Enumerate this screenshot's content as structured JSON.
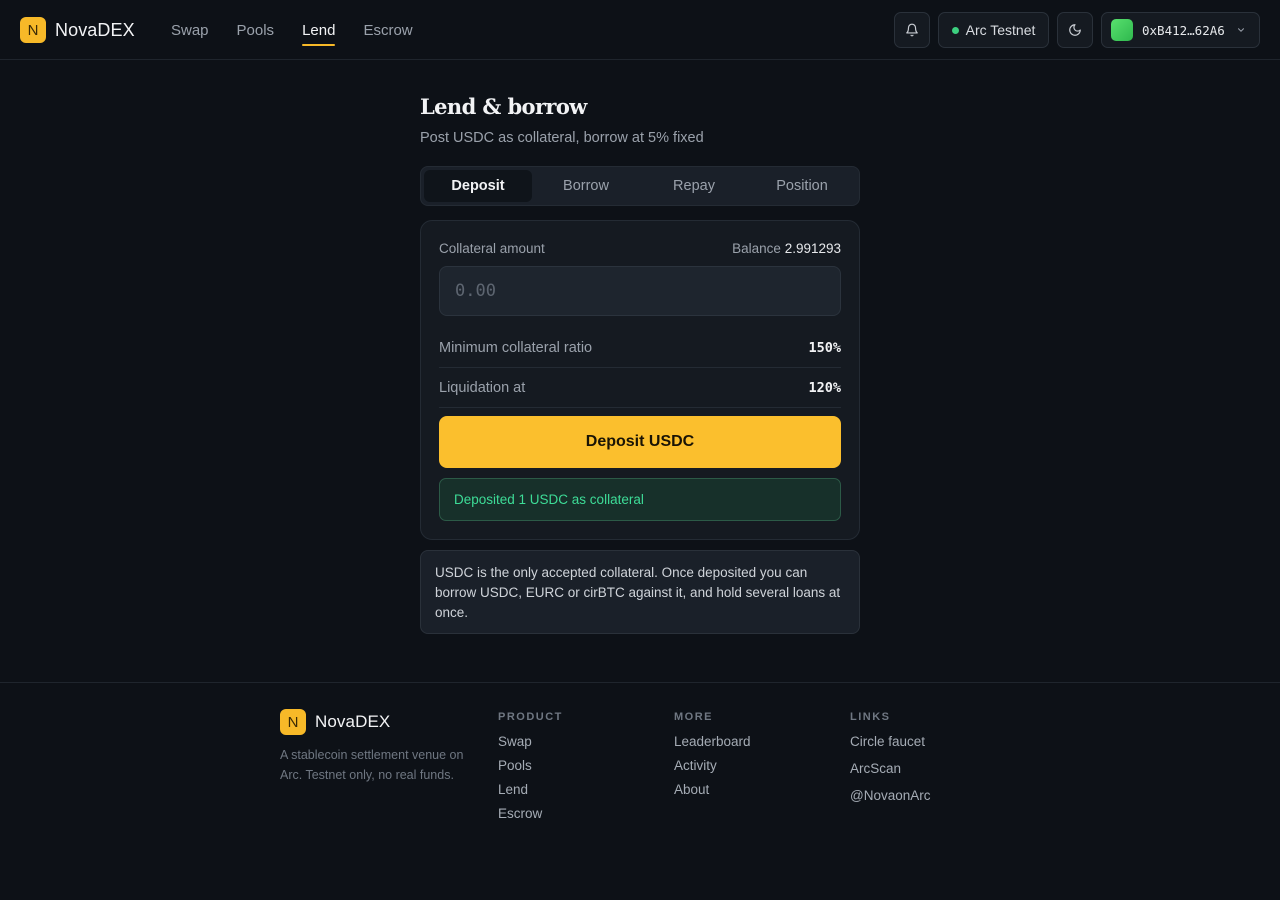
{
  "header": {
    "logo_letter": "N",
    "brand": "NovaDEX",
    "nav": [
      {
        "label": "Swap"
      },
      {
        "label": "Pools"
      },
      {
        "label": "Lend",
        "active": true
      },
      {
        "label": "Escrow"
      }
    ],
    "network": "Arc Testnet",
    "wallet_address": "0xB412…62A6",
    "accent_color": "#f7b928"
  },
  "lend": {
    "title": "Lend & borrow",
    "subtitle": "Post USDC as collateral, borrow at 5% fixed",
    "tabs": [
      {
        "label": "Deposit",
        "active": true
      },
      {
        "label": "Borrow"
      },
      {
        "label": "Repay"
      },
      {
        "label": "Position"
      }
    ],
    "collateral_label": "Collateral amount",
    "balance_label": "Balance",
    "balance_value": "2.991293",
    "amount_placeholder": "0.00",
    "amount_value": "",
    "min_ratio_label": "Minimum collateral ratio",
    "min_ratio_value": "150%",
    "liquidation_label": "Liquidation at",
    "liquidation_value": "120%",
    "deposit_button": "Deposit USDC",
    "success_message": "Deposited 1 USDC as collateral",
    "info_text": "USDC is the only accepted collateral. Once deposited you can borrow USDC, EURC or cirBTC against it, and hold several loans at once."
  },
  "footer": {
    "logo_letter": "N",
    "brand": "NovaDEX",
    "tagline": "A stablecoin settlement venue on Arc. Testnet only, no real funds.",
    "product_title": "PRODUCT",
    "product_links": [
      "Swap",
      "Pools",
      "Lend",
      "Escrow"
    ],
    "more_title": "MORE",
    "more_links": [
      "Leaderboard",
      "Activity",
      "About"
    ],
    "links_title": "LINKS",
    "links_links": [
      "Circle faucet",
      "ArcScan",
      "@NovaonArc"
    ]
  },
  "icons": {
    "bell": "bell-icon",
    "moon": "moon-icon",
    "chevron": "chevron-down-icon",
    "status_dot_color": "#3ccf7f"
  }
}
